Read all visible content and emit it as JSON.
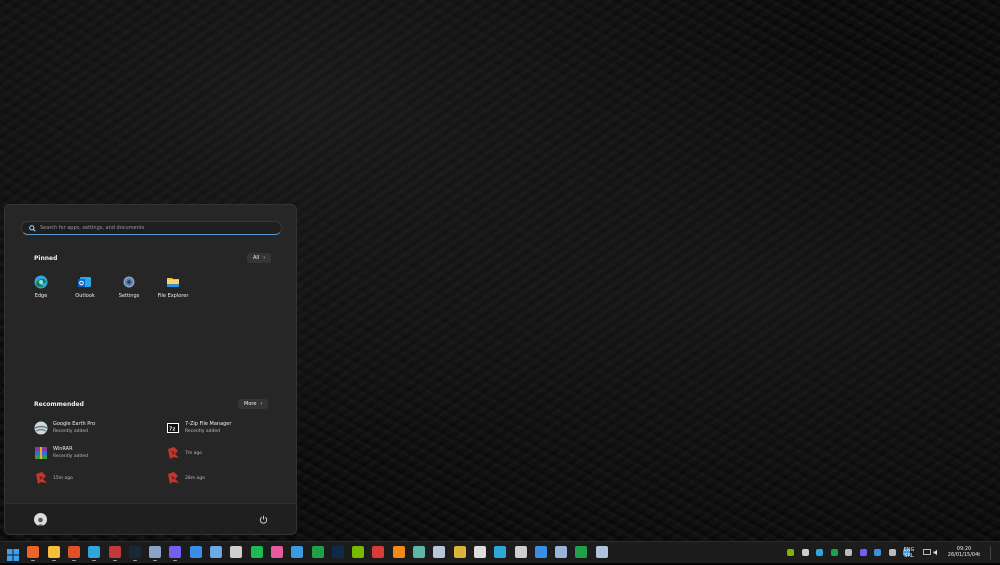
{
  "search": {
    "placeholder": "Search for apps, settings, and documents"
  },
  "pinned": {
    "title": "Pinned",
    "all_label": "All",
    "items": [
      {
        "label": "Edge",
        "icon": "edge-icon"
      },
      {
        "label": "Outlook",
        "icon": "outlook-icon"
      },
      {
        "label": "Settings",
        "icon": "settings-gear-icon"
      },
      {
        "label": "File Explorer",
        "icon": "folder-icon"
      }
    ]
  },
  "recommended": {
    "title": "Recommended",
    "more_label": "More",
    "items": [
      {
        "name": "Google Earth Pro",
        "sub": "Recently added",
        "icon": "google-earth-icon"
      },
      {
        "name": "7-Zip File Manager",
        "sub": "Recently added",
        "icon": "7zip-icon"
      },
      {
        "name": "WinRAR",
        "sub": "Recently added",
        "icon": "winrar-icon"
      },
      {
        "name": "",
        "sub": "7m ago",
        "icon": "file-icon"
      },
      {
        "name": "",
        "sub": "15m ago",
        "icon": "file-icon"
      },
      {
        "name": "",
        "sub": "28m ago",
        "icon": "file-icon"
      }
    ]
  },
  "taskbar": {
    "apps": [
      {
        "name": "start-icon",
        "color": "#3aa0f3"
      },
      {
        "name": "firefox-icon",
        "color": "#e8662a"
      },
      {
        "name": "file-explorer-icon",
        "color": "#f5c13d"
      },
      {
        "name": "brave-icon",
        "color": "#e0502b"
      },
      {
        "name": "edge-icon",
        "color": "#2fa6d9"
      },
      {
        "name": "steam-icon",
        "color": "#c23a3a"
      },
      {
        "name": "steam-client-icon",
        "color": "#1b2838"
      },
      {
        "name": "settings-icon",
        "color": "#8aa4c8"
      },
      {
        "name": "viber-icon",
        "color": "#7360f2"
      },
      {
        "name": "mail-icon",
        "color": "#3a8ee6"
      },
      {
        "name": "photos-icon",
        "color": "#6aa9e6"
      },
      {
        "name": "notepad-icon",
        "color": "#cfcfcf"
      },
      {
        "name": "spotify-icon",
        "color": "#1db954"
      },
      {
        "name": "paint-icon",
        "color": "#e85aa0"
      },
      {
        "name": "photos-app-icon",
        "color": "#3a9be0"
      },
      {
        "name": "wordpress-icon",
        "color": "#21a04a"
      },
      {
        "name": "photoshop-icon",
        "color": "#0d2a4a"
      },
      {
        "name": "nvidia-icon",
        "color": "#76b900"
      },
      {
        "name": "unity-icon",
        "color": "#d93a3a"
      },
      {
        "name": "vlc-icon",
        "color": "#f08a1d"
      },
      {
        "name": "calculator-icon",
        "color": "#5fb5a8"
      },
      {
        "name": "document-icon",
        "color": "#b8c4d8"
      },
      {
        "name": "shield-icon",
        "color": "#d9b33a"
      },
      {
        "name": "g-app-icon",
        "color": "#dddddd"
      },
      {
        "name": "logitech-icon",
        "color": "#2fa6d9"
      },
      {
        "name": "disk-icon",
        "color": "#cfcfcf"
      },
      {
        "name": "grid-app-icon",
        "color": "#3a8ee6"
      },
      {
        "name": "equalizer-icon",
        "color": "#9ab4d9"
      },
      {
        "name": "wolfram-icon",
        "color": "#21a04a"
      },
      {
        "name": "remote-desktop-icon",
        "color": "#b0c4de"
      }
    ],
    "tray": [
      {
        "name": "nvidia-tray-icon",
        "color": "#76b900"
      },
      {
        "name": "dropbox-tray-icon",
        "color": "#cccccc"
      },
      {
        "name": "logitech-tray-icon",
        "color": "#2fa6d9"
      },
      {
        "name": "wordpress-tray-icon",
        "color": "#21a04a"
      },
      {
        "name": "steam-tray-icon",
        "color": "#bbbbbb"
      },
      {
        "name": "viber-tray-icon",
        "color": "#7360f2"
      },
      {
        "name": "bluetooth-tray-icon",
        "color": "#3a8ee6"
      },
      {
        "name": "steam2-tray-icon",
        "color": "#bbbbbb"
      },
      {
        "name": "windows-security-tray-icon",
        "color": "#3aa0f3"
      }
    ],
    "lang_top": "ENG",
    "lang_bottom": "SRL",
    "time": "09:20",
    "date": "26/01/15/04t"
  }
}
